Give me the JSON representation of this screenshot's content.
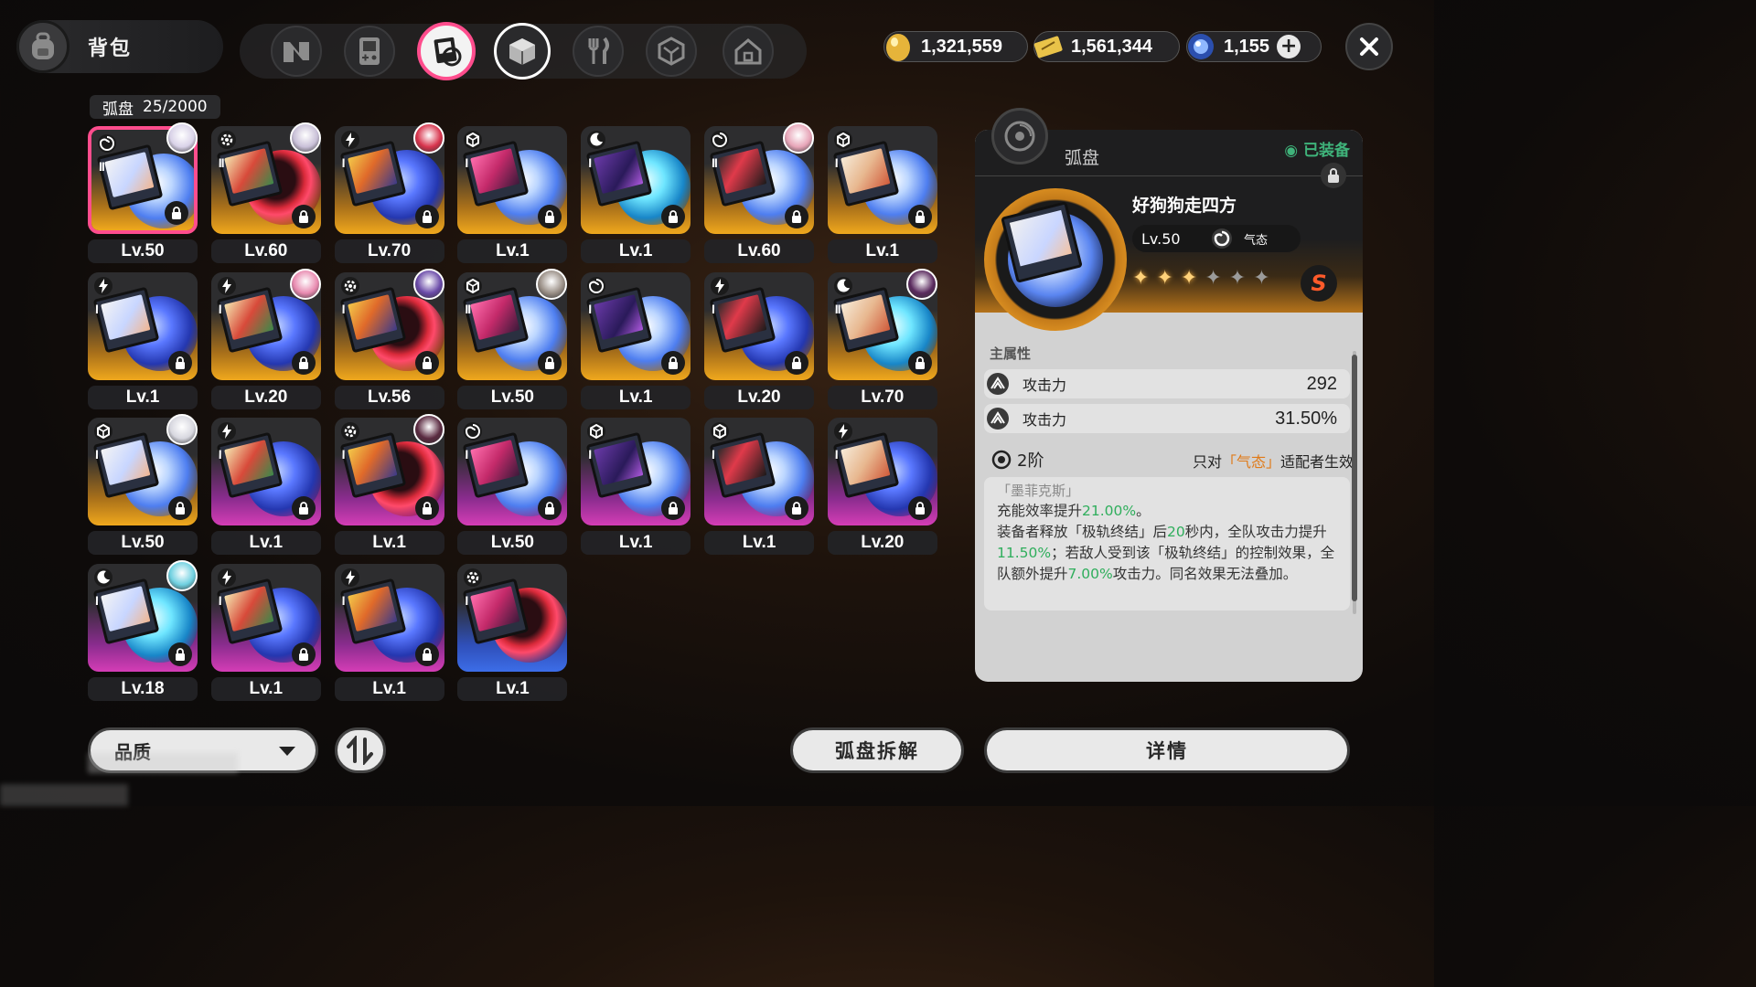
{
  "header": {
    "title": "背包"
  },
  "tabs": [
    {
      "name": "n-logo-tab",
      "active": false
    },
    {
      "name": "gameboy-tab",
      "active": false
    },
    {
      "name": "disc-tab",
      "active": true
    },
    {
      "name": "box-tab",
      "active": false
    },
    {
      "name": "food-tab",
      "active": false
    },
    {
      "name": "crystal-tab",
      "active": false
    },
    {
      "name": "house-tab",
      "active": false
    }
  ],
  "currencies": [
    {
      "icon": "gold-egg-icon",
      "amount": "1,321,559"
    },
    {
      "icon": "ticket-icon",
      "amount": "1,561,344"
    },
    {
      "icon": "blue-gem-icon",
      "amount": "1,155"
    }
  ],
  "inventory": {
    "label": "弧盘",
    "count": "25/2000",
    "items": [
      {
        "level": "Lv.50",
        "rank": "II",
        "rarity": "gold",
        "attr": "swirl",
        "disc": "swirl",
        "avatar": "#d9d2e8",
        "selected": true
      },
      {
        "level": "Lv.60",
        "rank": "II",
        "rarity": "gold",
        "attr": "gear",
        "disc": "red",
        "avatar": "#c9c0d8"
      },
      {
        "level": "Lv.70",
        "rank": "I",
        "rarity": "gold",
        "attr": "bolt",
        "disc": "storm",
        "avatar": "#d8344d"
      },
      {
        "level": "Lv.1",
        "rank": "I",
        "rarity": "gold",
        "attr": "cube",
        "disc": "swirl"
      },
      {
        "level": "Lv.1",
        "rank": "I",
        "rarity": "gold",
        "attr": "moon",
        "disc": "cyan"
      },
      {
        "level": "Lv.60",
        "rank": "II",
        "rarity": "gold",
        "attr": "swirl",
        "disc": "swirl",
        "avatar": "#e7a5b8"
      },
      {
        "level": "Lv.1",
        "rank": "I",
        "rarity": "gold",
        "attr": "cube",
        "disc": "swirl"
      },
      {
        "level": "Lv.1",
        "rank": "I",
        "rarity": "gold",
        "attr": "bolt",
        "disc": "storm"
      },
      {
        "level": "Lv.20",
        "rank": "I",
        "rarity": "gold",
        "attr": "bolt",
        "disc": "storm",
        "avatar": "#e88ab0"
      },
      {
        "level": "Lv.56",
        "rank": "I",
        "rarity": "gold",
        "attr": "gear",
        "disc": "red",
        "avatar": "#6a4aa8"
      },
      {
        "level": "Lv.50",
        "rank": "II",
        "rarity": "gold",
        "attr": "cube",
        "disc": "swirl",
        "avatar": "#9a8f86"
      },
      {
        "level": "Lv.1",
        "rank": "I",
        "rarity": "gold",
        "attr": "swirl",
        "disc": "swirl"
      },
      {
        "level": "Lv.20",
        "rank": "I",
        "rarity": "gold",
        "attr": "bolt",
        "disc": "storm"
      },
      {
        "level": "Lv.70",
        "rank": "II",
        "rarity": "gold",
        "attr": "moon",
        "disc": "cyan",
        "avatar": "#5a2a5e"
      },
      {
        "level": "Lv.50",
        "rank": "I",
        "rarity": "gold",
        "attr": "cube",
        "disc": "swirl",
        "avatar": "#d7d7df"
      },
      {
        "level": "Lv.1",
        "rank": "I",
        "rarity": "purple",
        "attr": "bolt",
        "disc": "storm"
      },
      {
        "level": "Lv.1",
        "rank": "I",
        "rarity": "purple",
        "attr": "gear",
        "disc": "red",
        "avatar": "#5a2a40"
      },
      {
        "level": "Lv.50",
        "rank": "I",
        "rarity": "purple",
        "attr": "swirl",
        "disc": "swirl"
      },
      {
        "level": "Lv.1",
        "rank": "I",
        "rarity": "purple",
        "attr": "cube",
        "disc": "swirl"
      },
      {
        "level": "Lv.1",
        "rank": "I",
        "rarity": "purple",
        "attr": "cube",
        "disc": "swirl"
      },
      {
        "level": "Lv.20",
        "rank": "I",
        "rarity": "purple",
        "attr": "bolt",
        "disc": "storm"
      },
      {
        "level": "Lv.18",
        "rank": "I",
        "rarity": "purple",
        "attr": "moon",
        "disc": "cyan",
        "avatar": "#6fd0e0"
      },
      {
        "level": "Lv.1",
        "rank": "I",
        "rarity": "purple",
        "attr": "bolt",
        "disc": "storm"
      },
      {
        "level": "Lv.1",
        "rank": "I",
        "rarity": "purple",
        "attr": "bolt",
        "disc": "storm"
      },
      {
        "level": "Lv.1",
        "rank": "I",
        "rarity": "blue",
        "attr": "gear",
        "disc": "red",
        "noLock": true
      }
    ]
  },
  "bottom": {
    "quality_label": "品质",
    "dismantle_label": "弧盘拆解",
    "details_label": "详情"
  },
  "detail": {
    "category": "弧盘",
    "equipped_label": "◉ 已装备",
    "name": "好狗狗走四方",
    "level": "Lv.50",
    "attribute": "气态",
    "stars_on": 3,
    "stars_total": 6,
    "main_attr_title": "主属性",
    "attrs": [
      {
        "name": "攻击力",
        "value": "292"
      },
      {
        "name": "攻击力",
        "value": "31.50%"
      }
    ],
    "tier_label": "2阶",
    "tier_note_pre": "只对",
    "tier_note_hl": "「气态」",
    "tier_note_post": "适配者生效",
    "effect_title": "「墨菲克斯」",
    "effect_parts": [
      {
        "t": "充能效率提升",
        "g": false
      },
      {
        "t": "21.00%",
        "g": true
      },
      {
        "t": "。",
        "g": false
      },
      {
        "t": "\n装备者释放「极轨终结」后",
        "g": false
      },
      {
        "t": "20",
        "g": true
      },
      {
        "t": "秒内，全队攻击力提升",
        "g": false
      },
      {
        "t": "11.50%",
        "g": true
      },
      {
        "t": "；若敌人受到该「极轨终结」的控制效果，全队额外提升",
        "g": false
      },
      {
        "t": "7.00%",
        "g": true
      },
      {
        "t": "攻击力。同名效果无法叠加。",
        "g": false
      }
    ]
  }
}
